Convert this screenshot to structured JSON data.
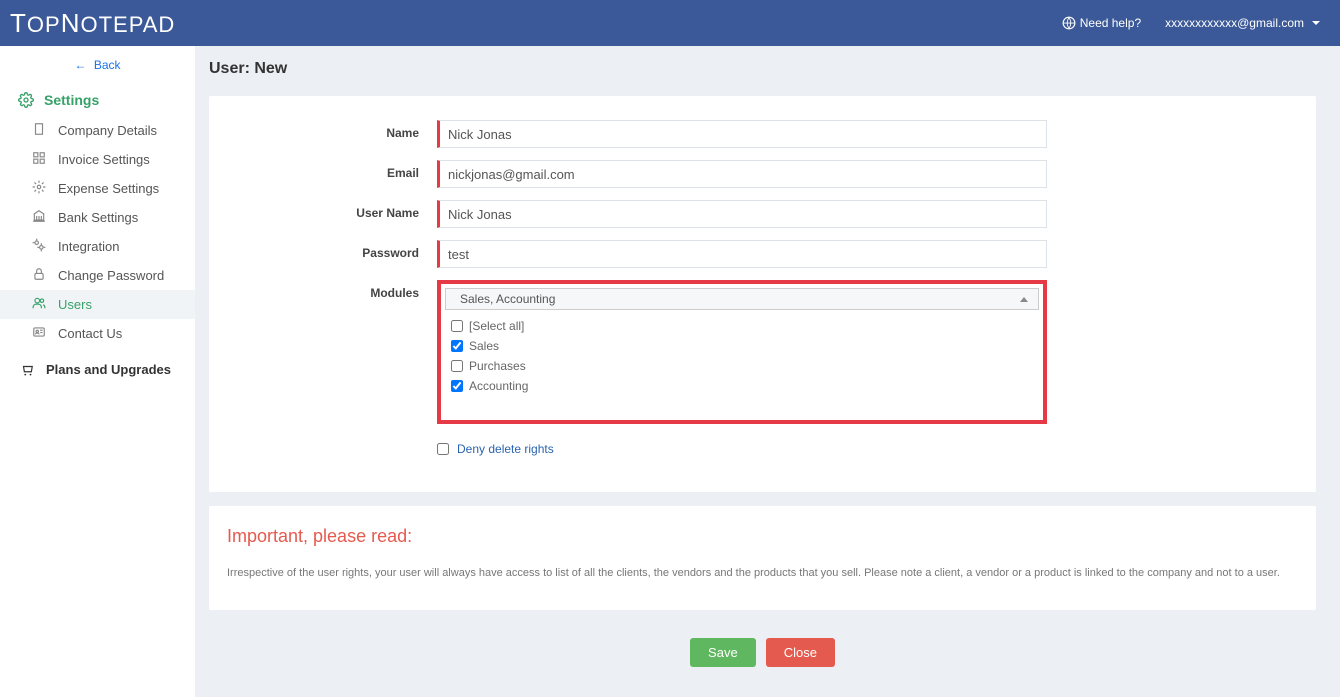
{
  "header": {
    "logo_text": "TopNotepad",
    "need_help": "Need help?",
    "user_email": "xxxxxxxxxxxx@gmail.com"
  },
  "sidebar": {
    "back_label": "Back",
    "settings_label": "Settings",
    "items": [
      {
        "label": "Company Details",
        "icon": "building"
      },
      {
        "label": "Invoice Settings",
        "icon": "grid"
      },
      {
        "label": "Expense Settings",
        "icon": "gear"
      },
      {
        "label": "Bank Settings",
        "icon": "bank"
      },
      {
        "label": "Integration",
        "icon": "cog"
      },
      {
        "label": "Change Password",
        "icon": "lock"
      },
      {
        "label": "Users",
        "icon": "users",
        "active": true
      },
      {
        "label": "Contact Us",
        "icon": "idcard"
      }
    ],
    "plans_label": "Plans and Upgrades"
  },
  "page": {
    "title": "User: New",
    "labels": {
      "name": "Name",
      "email": "Email",
      "username": "User Name",
      "password": "Password",
      "modules": "Modules"
    },
    "values": {
      "name": "Nick Jonas",
      "email": "nickjonas@gmail.com",
      "username": "Nick Jonas",
      "password": "test"
    },
    "modules": {
      "selected_text": "Sales, Accounting",
      "options": [
        {
          "label": "[Select all]",
          "checked": false
        },
        {
          "label": "Sales",
          "checked": true
        },
        {
          "label": "Purchases",
          "checked": false
        },
        {
          "label": "Accounting",
          "checked": true
        }
      ]
    },
    "deny_label": "Deny delete rights",
    "important_title": "Important, please read:",
    "important_text": "Irrespective of the user rights, your user will always have access to list of all the clients, the vendors and the products that you sell. Please note a client, a vendor or a product is linked to the company and not to a user.",
    "save_label": "Save",
    "close_label": "Close"
  }
}
